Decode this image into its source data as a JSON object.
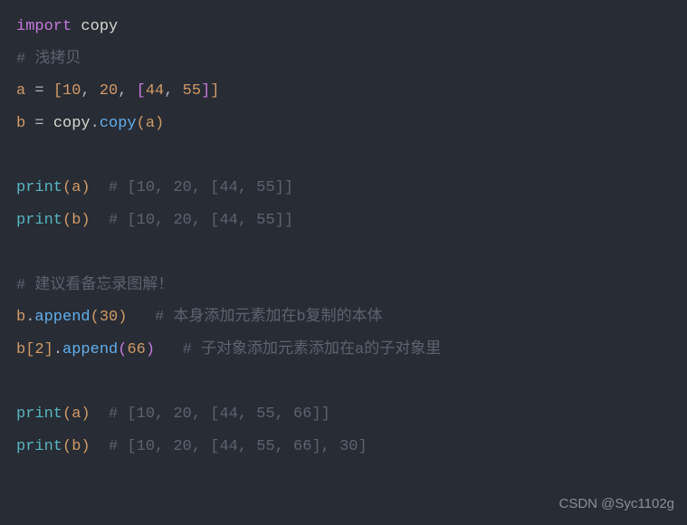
{
  "lines": {
    "l1_import": "import",
    "l1_module": " copy",
    "l2_comment": "# 浅拷贝",
    "l3_var": "a",
    "l3_eq": " = ",
    "l3_br1o": "[",
    "l3_n1": "10",
    "l3_c1": ", ",
    "l3_n2": "20",
    "l3_c2": ", ",
    "l3_br2o": "[",
    "l3_n3": "44",
    "l3_c3": ", ",
    "l3_n4": "55",
    "l3_br2c": "]",
    "l3_br1c": "]",
    "l4_var": "b",
    "l4_eq": " = ",
    "l4_mod": "copy",
    "l4_dot": ".",
    "l4_func": "copy",
    "l4_po": "(",
    "l4_arg": "a",
    "l4_pc": ")",
    "l6_fn": "print",
    "l6_po": "(",
    "l6_arg": "a",
    "l6_pc": ")",
    "l6_comment": "  # [10, 20, [44, 55]]",
    "l7_fn": "print",
    "l7_po": "(",
    "l7_arg": "b",
    "l7_pc": ")",
    "l7_comment": "  # [10, 20, [44, 55]]",
    "l9_comment": "# 建议看备忘录图解！",
    "l10_var": "b",
    "l10_dot": ".",
    "l10_func": "append",
    "l10_po": "(",
    "l10_arg": "30",
    "l10_pc": ")",
    "l10_comment": "   # 本身添加元素加在b复制的本体",
    "l11_var": "b",
    "l11_br1o": "[",
    "l11_idx": "2",
    "l11_br1c": "]",
    "l11_dot": ".",
    "l11_func": "append",
    "l11_po": "(",
    "l11_arg": "66",
    "l11_pc": ")",
    "l11_comment": "   # 子对象添加元素添加在a的子对象里",
    "l13_fn": "print",
    "l13_po": "(",
    "l13_arg": "a",
    "l13_pc": ")",
    "l13_comment": "  # [10, 20, [44, 55, 66]]",
    "l14_fn": "print",
    "l14_po": "(",
    "l14_arg": "b",
    "l14_pc": ")",
    "l14_comment": "  # [10, 20, [44, 55, 66], 30]"
  },
  "watermark": "CSDN @Syc1102g"
}
